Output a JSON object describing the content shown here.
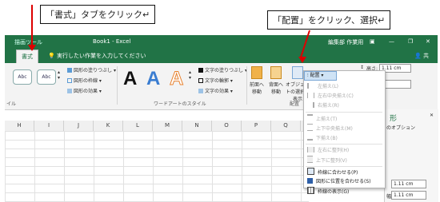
{
  "callouts": {
    "format_tab": "「書式」タブをクリック↵",
    "arrange": "「配置」をクリック、選択↵"
  },
  "titlebar": {
    "context": "描画ツール",
    "title": "Book1 - Excel",
    "user": "編集部 作業用"
  },
  "tabs": {
    "format": "書式",
    "tellme": "実行したい作業を入力してください",
    "share": "共有"
  },
  "ribbon": {
    "shape_style_label": "Abc",
    "fill": "図形の塗りつぶし",
    "outline": "図形の枠線",
    "effects": "図形の効果",
    "group_shape_styles": "イル",
    "wordart_letter": "A",
    "text_fill": "文字の塗りつぶし",
    "text_outline": "文字の輪郭",
    "text_effects": "文字の効果",
    "group_wordart": "ワードアートのスタイル",
    "bring_forward": "前面へ移動",
    "send_backward": "背面へ移動",
    "selection_pane": "オブジェクトの選択と表示",
    "group_arrange": "配置",
    "align_btn": "配置",
    "height_label": "高さ:",
    "height_value": "1.11 cm"
  },
  "columns": [
    "H",
    "I",
    "J",
    "K",
    "L",
    "M",
    "N",
    "O",
    "P",
    "Q"
  ],
  "dropdown": {
    "items": [
      {
        "label": "左揃え(L)",
        "disabled": true
      },
      {
        "label": "左右中央揃え(C)",
        "disabled": true
      },
      {
        "label": "右揃え(R)",
        "disabled": true
      },
      {
        "label": "上揃え(T)",
        "disabled": true
      },
      {
        "label": "上下中央揃え(M)",
        "disabled": true
      },
      {
        "label": "下揃え(B)",
        "disabled": true
      },
      {
        "label": "左右に整列(H)",
        "disabled": true
      },
      {
        "label": "上下に整列(V)",
        "disabled": true
      },
      {
        "label": "枠線に合わせる(P)",
        "disabled": false
      },
      {
        "label": "図形に位置を合わせる(S)",
        "disabled": false
      },
      {
        "label": "枠線の表示(G)",
        "disabled": false
      }
    ]
  },
  "pane": {
    "title": "形",
    "options": "のオプション",
    "width_label": "幅(D)",
    "height_value": "1.11 cm",
    "width_value": "1.11 cm"
  },
  "colors": {
    "excel_green": "#217346",
    "arrow_red": "#dd0000"
  }
}
